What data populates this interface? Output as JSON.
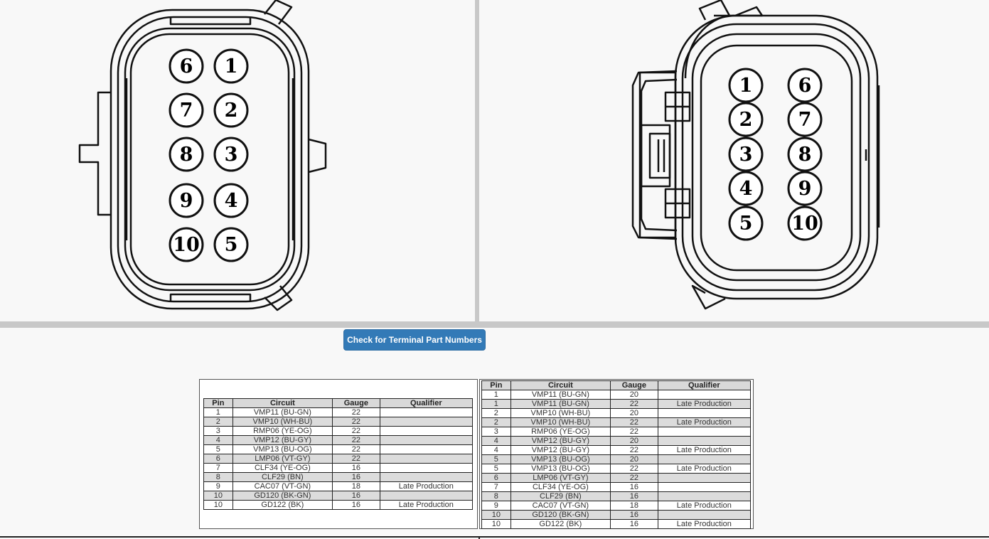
{
  "connector_left": {
    "pins": [
      {
        "label": "6"
      },
      {
        "label": "1"
      },
      {
        "label": "7"
      },
      {
        "label": "2"
      },
      {
        "label": "8"
      },
      {
        "label": "3"
      },
      {
        "label": "9"
      },
      {
        "label": "4"
      },
      {
        "label": "10"
      },
      {
        "label": "5"
      }
    ]
  },
  "connector_right": {
    "pins": [
      {
        "label": "1"
      },
      {
        "label": "6"
      },
      {
        "label": "2"
      },
      {
        "label": "7"
      },
      {
        "label": "3"
      },
      {
        "label": "8"
      },
      {
        "label": "4"
      },
      {
        "label": "9"
      },
      {
        "label": "5"
      },
      {
        "label": "10"
      }
    ]
  },
  "button": {
    "label": "Check for Terminal Part Numbers"
  },
  "table_headers": {
    "pin": "Pin",
    "circuit": "Circuit",
    "gauge": "Gauge",
    "qualifier": "Qualifier"
  },
  "table_left": {
    "rows": [
      {
        "pin": "1",
        "circuit": "VMP11 (BU-GN)",
        "gauge": "22",
        "qualifier": ""
      },
      {
        "pin": "2",
        "circuit": "VMP10 (WH-BU)",
        "gauge": "22",
        "qualifier": ""
      },
      {
        "pin": "3",
        "circuit": "RMP06 (YE-OG)",
        "gauge": "22",
        "qualifier": ""
      },
      {
        "pin": "4",
        "circuit": "VMP12 (BU-GY)",
        "gauge": "22",
        "qualifier": ""
      },
      {
        "pin": "5",
        "circuit": "VMP13 (BU-OG)",
        "gauge": "22",
        "qualifier": ""
      },
      {
        "pin": "6",
        "circuit": "LMP06 (VT-GY)",
        "gauge": "22",
        "qualifier": ""
      },
      {
        "pin": "7",
        "circuit": "CLF34 (YE-OG)",
        "gauge": "16",
        "qualifier": ""
      },
      {
        "pin": "8",
        "circuit": "CLF29 (BN)",
        "gauge": "16",
        "qualifier": ""
      },
      {
        "pin": "9",
        "circuit": "CAC07 (VT-GN)",
        "gauge": "18",
        "qualifier": "Late Production"
      },
      {
        "pin": "10",
        "circuit": "GD120 (BK-GN)",
        "gauge": "16",
        "qualifier": ""
      },
      {
        "pin": "10",
        "circuit": "GD122 (BK)",
        "gauge": "16",
        "qualifier": "Late Production"
      }
    ]
  },
  "table_right": {
    "rows": [
      {
        "pin": "1",
        "circuit": "VMP11 (BU-GN)",
        "gauge": "20",
        "qualifier": ""
      },
      {
        "pin": "1",
        "circuit": "VMP11 (BU-GN)",
        "gauge": "22",
        "qualifier": "Late Production"
      },
      {
        "pin": "2",
        "circuit": "VMP10 (WH-BU)",
        "gauge": "20",
        "qualifier": ""
      },
      {
        "pin": "2",
        "circuit": "VMP10 (WH-BU)",
        "gauge": "22",
        "qualifier": "Late Production"
      },
      {
        "pin": "3",
        "circuit": "RMP06 (YE-OG)",
        "gauge": "22",
        "qualifier": ""
      },
      {
        "pin": "4",
        "circuit": "VMP12 (BU-GY)",
        "gauge": "20",
        "qualifier": ""
      },
      {
        "pin": "4",
        "circuit": "VMP12 (BU-GY)",
        "gauge": "22",
        "qualifier": "Late Production"
      },
      {
        "pin": "5",
        "circuit": "VMP13 (BU-OG)",
        "gauge": "20",
        "qualifier": ""
      },
      {
        "pin": "5",
        "circuit": "VMP13 (BU-OG)",
        "gauge": "22",
        "qualifier": "Late Production"
      },
      {
        "pin": "6",
        "circuit": "LMP06 (VT-GY)",
        "gauge": "22",
        "qualifier": ""
      },
      {
        "pin": "7",
        "circuit": "CLF34 (YE-OG)",
        "gauge": "16",
        "qualifier": ""
      },
      {
        "pin": "8",
        "circuit": "CLF29 (BN)",
        "gauge": "16",
        "qualifier": ""
      },
      {
        "pin": "9",
        "circuit": "CAC07 (VT-GN)",
        "gauge": "18",
        "qualifier": "Late Production"
      },
      {
        "pin": "10",
        "circuit": "GD120 (BK-GN)",
        "gauge": "16",
        "qualifier": ""
      },
      {
        "pin": "10",
        "circuit": "GD122 (BK)",
        "gauge": "16",
        "qualifier": "Late Production"
      }
    ]
  },
  "colors": {
    "button_bg": "#337ab7",
    "divider": "#c8c8c8",
    "row_alt": "#dcdcdc"
  }
}
